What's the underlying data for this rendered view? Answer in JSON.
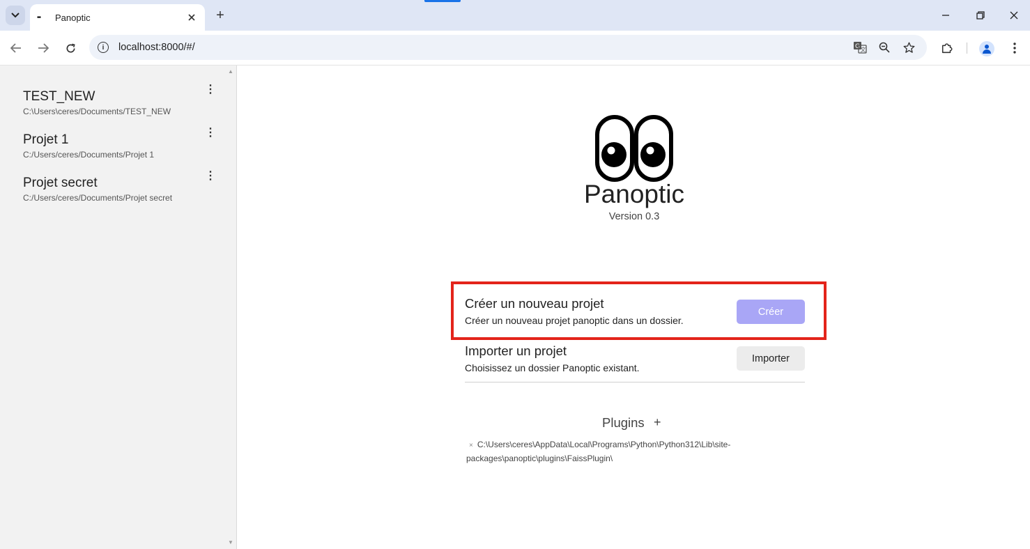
{
  "browser": {
    "tab_title": "Panoptic",
    "tab_favicon": "••",
    "new_tab_label": "+",
    "url": "localhost:8000/#/"
  },
  "icons": {
    "tab_list": "chevron-down-icon",
    "favicon": "eyes-icon",
    "tab_close": "close-icon",
    "new_tab": "plus-icon",
    "minimize": "minimize-icon",
    "restore": "restore-icon",
    "close_window": "close-icon",
    "back": "arrow-left-icon",
    "forward": "arrow-right-icon",
    "reload": "reload-icon",
    "site_info": "info-icon",
    "translate": "translate-icon",
    "zoom": "zoom-out-icon",
    "bookmark": "star-icon",
    "extensions": "puzzle-icon",
    "profile": "avatar-icon",
    "menu": "more-vert-icon",
    "project_menu": "more-vert-icon",
    "plugin_add": "plus-icon",
    "plugin_remove": "close-icon"
  },
  "sidebar": {
    "projects": [
      {
        "name": "TEST_NEW",
        "path": "C:\\Users\\ceres/Documents/TEST_NEW"
      },
      {
        "name": "Projet 1",
        "path": "C:/Users/ceres/Documents/Projet 1"
      },
      {
        "name": "Projet secret",
        "path": "C:/Users/ceres/Documents/Projet secret"
      }
    ]
  },
  "app": {
    "name": "Panoptic",
    "version": "Version 0.3"
  },
  "actions": {
    "create": {
      "title": "Créer un nouveau projet",
      "description": "Créer un nouveau projet panoptic dans un dossier.",
      "button": "Créer"
    },
    "import": {
      "title": "Importer un projet",
      "description": "Choisissez un dossier Panoptic existant.",
      "button": "Importer"
    }
  },
  "plugins": {
    "title": "Plugins",
    "add_label": "+",
    "remove_label": "×",
    "items": [
      "C:\\Users\\ceres\\AppData\\Local\\Programs\\Python\\Python312\\Lib\\site-packages\\panoptic\\plugins\\FaissPlugin\\"
    ]
  },
  "colors": {
    "highlight": "#e3241b",
    "create_button": "#a9a6f6",
    "sidebar_bg": "#f2f2f2"
  }
}
